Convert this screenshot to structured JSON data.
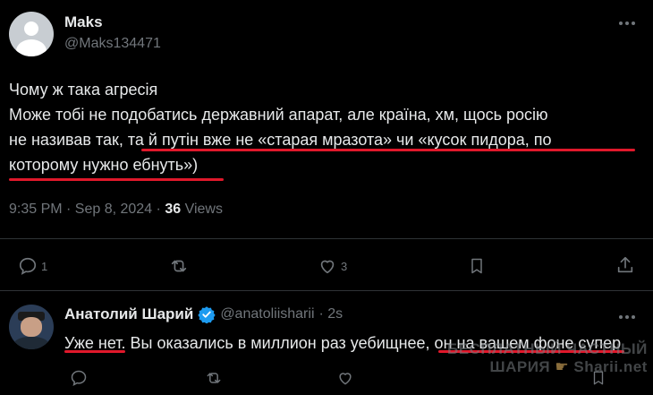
{
  "tweet": {
    "author_name": "Maks",
    "author_handle": "@Maks134471",
    "lines": [
      "Чому ж така агресія",
      "Може тобі не подобатись державний апарат, але країна, хм, щось росію",
      "не називав так, та й путін вже не «старая мразота» чи «кусок пидора, по",
      "которому нужно ебнуть»)"
    ],
    "time": "9:35 PM · Sep 8, 2024 ·",
    "views_count": "36",
    "views_label": "Views",
    "actions": {
      "reply_count": "1",
      "repost_count": "",
      "like_count": "3"
    },
    "highlight_color": "#e0182b"
  },
  "reply": {
    "author_name": "Анатолий Шарий",
    "author_handle": "@anatoliisharii",
    "time": "· 2s",
    "text": "Уже нет. Вы оказались в миллион раз уебищнее, он на вашем фоне супер",
    "verified_color": "#1d9bf0"
  },
  "watermark": {
    "line1": "БЕСПЛАТНЫЙ ЧАСТНЫЙ",
    "line2": "ШАРИЯ",
    "line3": "Sharii.net"
  }
}
